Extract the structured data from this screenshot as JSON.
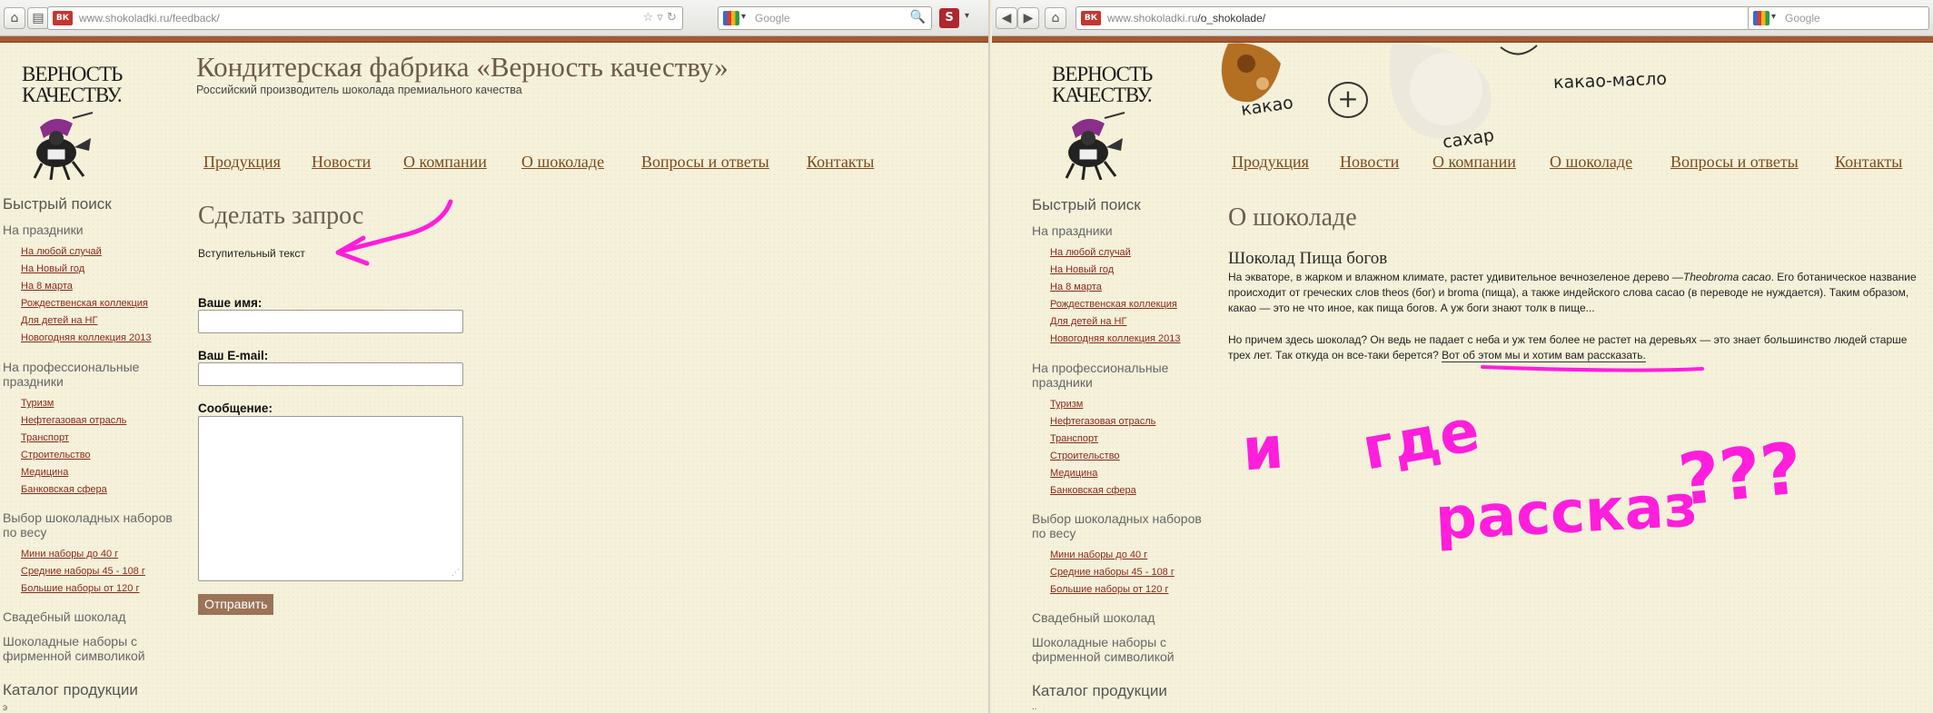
{
  "left": {
    "browser": {
      "favicon": "ВК",
      "url_domain": "www.shokoladki.ru",
      "url_path": "/feedback/",
      "search_placeholder": "Google",
      "ext_label": "S"
    },
    "logo": {
      "line1": "ВЕРНОСТЬ",
      "line2": "КАЧЕСТВУ."
    },
    "site_title": "Кондитерская фабрика «Верность качеству»",
    "site_subtitle": "Российский производитель шоколада премиального качества",
    "nav": [
      "Продукция",
      "Новости",
      "О компании",
      "О шоколаде",
      "Вопросы и ответы",
      "Контакты"
    ],
    "page_heading": "Сделать запрос",
    "intro_text": "Вступительный текст",
    "form": {
      "name_label": "Ваше имя:",
      "email_label": "Ваш E-mail:",
      "message_label": "Сообщение:",
      "submit_label": "Отправить"
    },
    "sidebar_bottom_char": "э"
  },
  "right": {
    "browser": {
      "favicon": "ВК",
      "url_domain": "www.shokoladki.ru",
      "url_path": "/o_shokolade/",
      "search_placeholder": "Google"
    },
    "logo": {
      "line1": "ВЕРНОСТЬ",
      "line2": "КАЧЕСТВУ."
    },
    "doodles": {
      "kakao": "какао",
      "sahar": "сахар",
      "maslo": "какао-масло"
    },
    "nav": [
      "Продукция",
      "Новости",
      "О компании",
      "О шоколаде",
      "Вопросы и ответы",
      "Контакты"
    ],
    "page_heading": "О шоколаде",
    "article_title": "Шоколад Пища богов",
    "para1_before": "На экваторе, в жарком и влажном климате, растет удивительное вечнозеленое дерево —",
    "para1_italic": "Theobroma cacao",
    "para1_after": ". Его ботаническое название происходит от греческих слов theos (бог) и broma (пища), а также индейского слова cacao (в переводе не нуждается). Таким образом, какао — это не что иное, как пища богов. А уж боги знают толк в пище...",
    "para2_before": "Но причем здесь шоколад? Он ведь не падает с неба и уж тем более не растет на деревьях — это знает большинство людей старше трех лет. Так откуда он все-таки берется? ",
    "para2_highlight": "Вот об этом мы и хотим вам рассказать.",
    "handwriting": {
      "w1": "и",
      "w2": "где",
      "w3": "рассказ",
      "w4": "???"
    },
    "sidebar_bottom_char": ".."
  },
  "sidebar": {
    "quick_search": "Быстрый поиск",
    "holidays": "На праздники",
    "holiday_links": [
      "На любой случай",
      "На Новый год",
      "На 8 марта",
      "Рождественская коллекция",
      "Для детей на НГ",
      "Новогодняя коллекция 2013"
    ],
    "pro_holidays": "На профессиональные праздники",
    "pro_links": [
      "Туризм",
      "Нефтегазовая отрасль",
      "Транспорт",
      "Строительство",
      "Медицина",
      "Банковская сфера"
    ],
    "by_weight": "Выбор шоколадных наборов по весу",
    "weight_links": [
      "Мини наборы до 40 г",
      "Средние наборы 45 - 108 г",
      "Большие наборы от 120 г"
    ],
    "wedding": "Свадебный шоколад",
    "branded": "Шоколадные наборы с фирменной символикой",
    "catalog": "Каталог продукции"
  },
  "colors": {
    "accent_bar": "#a25a34",
    "annotation": "#ff1edb",
    "link": "#8a2a1a"
  }
}
